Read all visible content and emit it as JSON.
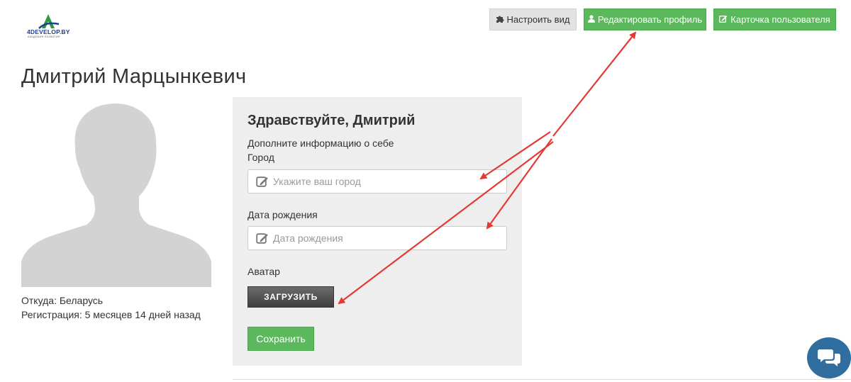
{
  "logo": {
    "text": "4DEVELOP.BY",
    "subtext": "АКАДЕМИЯ РАЗВИТИЯ"
  },
  "toolbar": {
    "customize_label": "Настроить вид",
    "edit_profile_label": "Редактировать профиль",
    "user_card_label": "Карточка пользователя"
  },
  "profile": {
    "name": "Дмитрий Марцынкевич",
    "from": "Откуда: Беларусь",
    "registered": "Регистрация: 5 месяцев 14 дней назад"
  },
  "form": {
    "greeting": "Здравствуйте, Дмитрий",
    "intro": "Дополните информацию о себе",
    "city_label": "Город",
    "city_placeholder": "Укажите ваш город",
    "city_value": "",
    "birth_label": "Дата рождения",
    "birth_placeholder": "Дата рождения",
    "birth_value": "",
    "avatar_label": "Аватар",
    "upload_label": "ЗАГРУЗИТЬ",
    "save_label": "Сохранить"
  },
  "colors": {
    "green": "#5cb85c",
    "gray_button": "#e2e2e2",
    "panel_bg": "#eeeeee",
    "annotation_red": "#e53935",
    "chat_blue": "#2f6e9f"
  },
  "icons": {
    "customize": "puzzle-icon",
    "edit_profile": "user-icon",
    "user_card": "edit-icon",
    "field": "pencil-square-icon",
    "chat": "chat-bubbles-icon"
  }
}
